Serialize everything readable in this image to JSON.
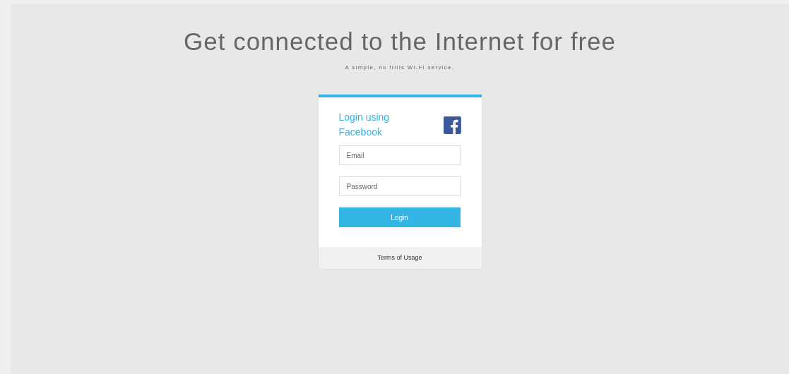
{
  "header": {
    "title": "Get connected to the Internet for free",
    "subtitle": "A simple, no frills Wi-Fi service."
  },
  "login_card": {
    "heading": "Login using Facebook",
    "email": {
      "placeholder": "Email"
    },
    "password": {
      "placeholder": "Password"
    },
    "button": "Login",
    "footer_link": "Terms of Usage"
  }
}
